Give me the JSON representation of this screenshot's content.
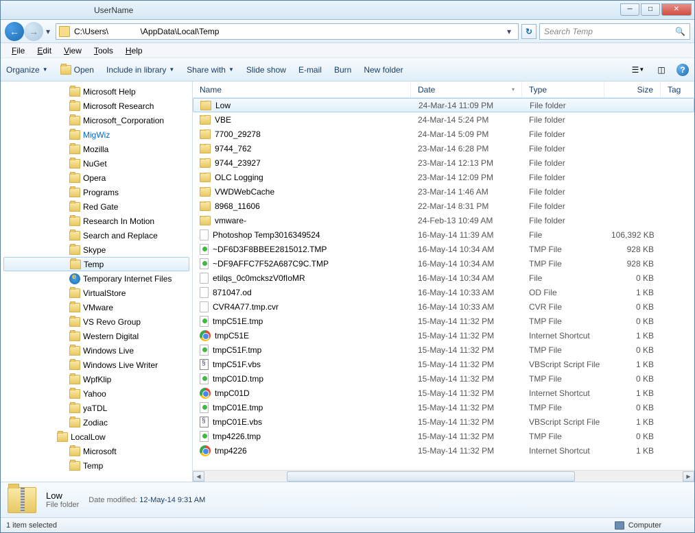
{
  "titlebar": {
    "label": "UserName"
  },
  "address": {
    "path": "C:\\Users\\              \\AppData\\Local\\Temp"
  },
  "search": {
    "placeholder": "Search Temp"
  },
  "menu": {
    "file": "File",
    "edit": "Edit",
    "view": "View",
    "tools": "Tools",
    "help": "Help"
  },
  "toolbar": {
    "organize": "Organize",
    "open": "Open",
    "include": "Include in library",
    "share": "Share with",
    "slideshow": "Slide show",
    "email": "E-mail",
    "burn": "Burn",
    "newfolder": "New folder"
  },
  "tree": [
    {
      "label": "Microsoft Help",
      "lvl": 2
    },
    {
      "label": "Microsoft Research",
      "lvl": 2
    },
    {
      "label": "Microsoft_Corporation",
      "lvl": 2
    },
    {
      "label": "MigWiz",
      "lvl": 2,
      "link": true
    },
    {
      "label": "Mozilla",
      "lvl": 2
    },
    {
      "label": "NuGet",
      "lvl": 2
    },
    {
      "label": "Opera",
      "lvl": 2
    },
    {
      "label": "Programs",
      "lvl": 2
    },
    {
      "label": "Red Gate",
      "lvl": 2
    },
    {
      "label": "Research In Motion",
      "lvl": 2
    },
    {
      "label": "Search and Replace",
      "lvl": 2
    },
    {
      "label": "Skype",
      "lvl": 2
    },
    {
      "label": "Temp",
      "lvl": 2,
      "sel": true
    },
    {
      "label": "Temporary Internet Files",
      "lvl": 2,
      "ie": true
    },
    {
      "label": "VirtualStore",
      "lvl": 2
    },
    {
      "label": "VMware",
      "lvl": 2
    },
    {
      "label": "VS Revo Group",
      "lvl": 2
    },
    {
      "label": "Western Digital",
      "lvl": 2
    },
    {
      "label": "Windows Live",
      "lvl": 2
    },
    {
      "label": "Windows Live Writer",
      "lvl": 2
    },
    {
      "label": "WpfKlip",
      "lvl": 2
    },
    {
      "label": "Yahoo",
      "lvl": 2
    },
    {
      "label": "yaTDL",
      "lvl": 2
    },
    {
      "label": "Zodiac",
      "lvl": 2
    },
    {
      "label": "LocalLow",
      "lvl": 1
    },
    {
      "label": "Microsoft",
      "lvl": 2
    },
    {
      "label": "Temp",
      "lvl": 2
    }
  ],
  "columns": {
    "name": "Name",
    "date": "Date",
    "type": "Type",
    "size": "Size",
    "tags": "Tag"
  },
  "rows": [
    {
      "icon": "folder",
      "name": "Low",
      "date": "24-Mar-14 11:09 PM",
      "type": "File folder",
      "size": "",
      "sel": true
    },
    {
      "icon": "folder",
      "name": "VBE",
      "date": "24-Mar-14 5:24 PM",
      "type": "File folder",
      "size": ""
    },
    {
      "icon": "folder",
      "name": "7700_29278",
      "date": "24-Mar-14 5:09 PM",
      "type": "File folder",
      "size": ""
    },
    {
      "icon": "folder",
      "name": "9744_762",
      "date": "23-Mar-14 6:28 PM",
      "type": "File folder",
      "size": ""
    },
    {
      "icon": "folder",
      "name": "9744_23927",
      "date": "23-Mar-14 12:13 PM",
      "type": "File folder",
      "size": ""
    },
    {
      "icon": "folder",
      "name": "OLC Logging",
      "date": "23-Mar-14 12:09 PM",
      "type": "File folder",
      "size": ""
    },
    {
      "icon": "folder",
      "name": "VWDWebCache",
      "date": "23-Mar-14 1:46 AM",
      "type": "File folder",
      "size": ""
    },
    {
      "icon": "folder",
      "name": "8968_11606",
      "date": "22-Mar-14 8:31 PM",
      "type": "File folder",
      "size": ""
    },
    {
      "icon": "folder",
      "name": "vmware-",
      "date": "24-Feb-13 10:49 AM",
      "type": "File folder",
      "size": ""
    },
    {
      "icon": "file",
      "name": "Photoshop Temp3016349524",
      "date": "16-May-14 11:39 AM",
      "type": "File",
      "size": "106,392 KB"
    },
    {
      "icon": "tmp",
      "name": "~DF6D3F8BBEE2815012.TMP",
      "date": "16-May-14 10:34 AM",
      "type": "TMP File",
      "size": "928 KB"
    },
    {
      "icon": "tmp",
      "name": "~DF9AFFC7F52A687C9C.TMP",
      "date": "16-May-14 10:34 AM",
      "type": "TMP File",
      "size": "928 KB"
    },
    {
      "icon": "file",
      "name": "etilqs_0c0mckszV0fIoMR",
      "date": "16-May-14 10:34 AM",
      "type": "File",
      "size": "0 KB"
    },
    {
      "icon": "file",
      "name": "871047.od",
      "date": "16-May-14 10:33 AM",
      "type": "OD File",
      "size": "1 KB"
    },
    {
      "icon": "file",
      "name": "CVR4A77.tmp.cvr",
      "date": "16-May-14 10:33 AM",
      "type": "CVR File",
      "size": "0 KB"
    },
    {
      "icon": "tmp",
      "name": "tmpC51E.tmp",
      "date": "15-May-14 11:32 PM",
      "type": "TMP File",
      "size": "0 KB"
    },
    {
      "icon": "chrome",
      "name": "tmpC51E",
      "date": "15-May-14 11:32 PM",
      "type": "Internet Shortcut",
      "size": "1 KB"
    },
    {
      "icon": "tmp",
      "name": "tmpC51F.tmp",
      "date": "15-May-14 11:32 PM",
      "type": "TMP File",
      "size": "0 KB"
    },
    {
      "icon": "vbs",
      "name": "tmpC51F.vbs",
      "date": "15-May-14 11:32 PM",
      "type": "VBScript Script File",
      "size": "1 KB"
    },
    {
      "icon": "tmp",
      "name": "tmpC01D.tmp",
      "date": "15-May-14 11:32 PM",
      "type": "TMP File",
      "size": "0 KB"
    },
    {
      "icon": "chrome",
      "name": "tmpC01D",
      "date": "15-May-14 11:32 PM",
      "type": "Internet Shortcut",
      "size": "1 KB"
    },
    {
      "icon": "tmp",
      "name": "tmpC01E.tmp",
      "date": "15-May-14 11:32 PM",
      "type": "TMP File",
      "size": "0 KB"
    },
    {
      "icon": "vbs",
      "name": "tmpC01E.vbs",
      "date": "15-May-14 11:32 PM",
      "type": "VBScript Script File",
      "size": "1 KB"
    },
    {
      "icon": "tmp",
      "name": "tmp4226.tmp",
      "date": "15-May-14 11:32 PM",
      "type": "TMP File",
      "size": "0 KB"
    },
    {
      "icon": "chrome",
      "name": "tmp4226",
      "date": "15-May-14 11:32 PM",
      "type": "Internet Shortcut",
      "size": "1 KB"
    }
  ],
  "details": {
    "name": "Low",
    "type": "File folder",
    "modified_label": "Date modified:",
    "modified_value": "12-May-14 9:31 AM"
  },
  "status": {
    "left": "1 item selected",
    "right": "Computer"
  }
}
